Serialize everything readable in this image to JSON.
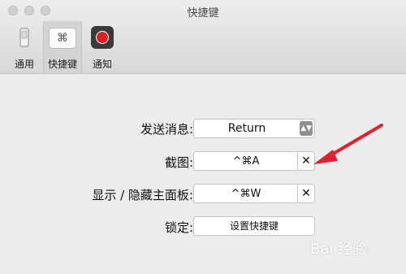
{
  "window": {
    "title": "快捷键"
  },
  "toolbar": {
    "tabs": [
      {
        "label": "通用"
      },
      {
        "label": "快捷键",
        "icon_glyph": "⌘"
      },
      {
        "label": "通知"
      }
    ]
  },
  "rows": {
    "send": {
      "label": "发送消息:",
      "value": "Return",
      "arrows": "▲▼"
    },
    "screenshot": {
      "label": "截图:",
      "value": "^⌘A",
      "clear": "✕"
    },
    "toggle_panel": {
      "label": "显示 / 隐藏主面板:",
      "value": "^⌘W",
      "clear": "✕"
    },
    "lock": {
      "label": "锁定:",
      "button": "设置快捷键"
    }
  },
  "watermark": {
    "text": "Bai 经验"
  },
  "colors": {
    "annotation_arrow": "#e02030",
    "notify_icon_red": "#e02020"
  }
}
